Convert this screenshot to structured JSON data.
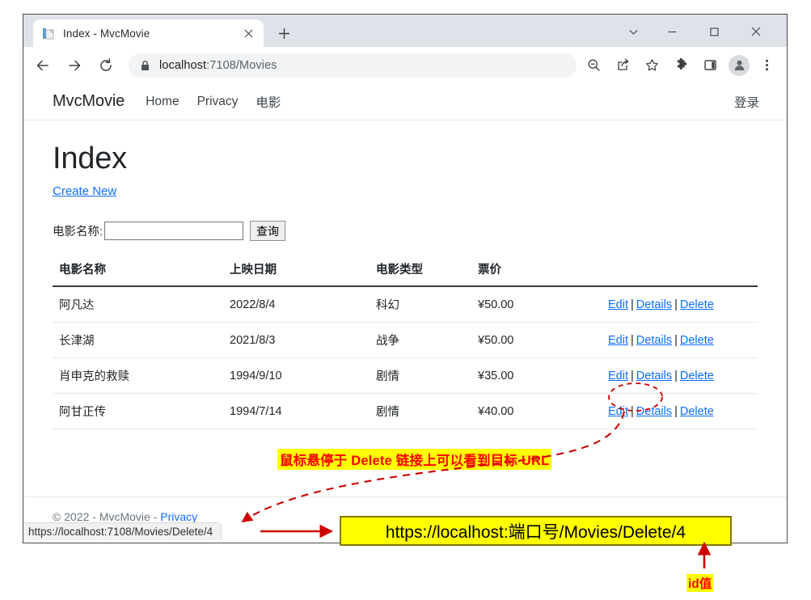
{
  "browser": {
    "tab": {
      "title": "Index - MvcMovie",
      "favicon_icon": "page-document-icon",
      "close_icon": "close-icon"
    },
    "new_tab_icon": "plus-icon",
    "window_controls": {
      "tab_search_icon": "chevron-down-icon",
      "minimize_icon": "minimize-icon",
      "maximize_icon": "maximize-square-icon",
      "close_icon": "close-x-icon"
    },
    "toolbar": {
      "back_icon": "arrow-left-icon",
      "forward_icon": "arrow-right-icon",
      "reload_icon": "reload-icon",
      "lock_icon": "lock-icon",
      "url_host": "localhost",
      "url_path": ":7108/Movies",
      "zoom_out_icon": "zoom-out-icon",
      "share_icon": "share-icon",
      "bookmark_icon": "star-outline-icon",
      "extensions_icon": "puzzle-piece-icon",
      "side_panel_icon": "side-panel-icon",
      "profile_icon": "account-avatar-icon",
      "menu_icon": "three-dot-menu-icon"
    },
    "status_bar": {
      "url": "https://localhost:7108/Movies/Delete/4"
    }
  },
  "site": {
    "brand": "MvcMovie",
    "nav_links": [
      "Home",
      "Privacy",
      "电影"
    ],
    "login_label": "登录",
    "footer": {
      "copyright": "© 2022 - MvcMovie - ",
      "privacy_label": "Privacy"
    }
  },
  "page": {
    "title": "Index",
    "create_new_label": "Create New",
    "search": {
      "label": "电影名称:",
      "value": "",
      "placeholder": "",
      "submit_label": "查询"
    },
    "table": {
      "headers": [
        "电影名称",
        "上映日期",
        "电影类型",
        "票价",
        ""
      ],
      "rows": [
        {
          "title": "阿凡达",
          "date": "2022/8/4",
          "genre": "科幻",
          "price": "¥50.00",
          "actions": [
            "Edit",
            "Details",
            "Delete"
          ]
        },
        {
          "title": "长津湖",
          "date": "2021/8/3",
          "genre": "战争",
          "price": "¥50.00",
          "actions": [
            "Edit",
            "Details",
            "Delete"
          ]
        },
        {
          "title": "肖申克的救赎",
          "date": "1994/9/10",
          "genre": "剧情",
          "price": "¥35.00",
          "actions": [
            "Edit",
            "Details",
            "Delete"
          ]
        },
        {
          "title": "阿甘正传",
          "date": "1994/7/14",
          "genre": "剧情",
          "price": "¥40.00",
          "actions": [
            "Edit",
            "Details",
            "Delete"
          ]
        }
      ],
      "action_separator": "|"
    }
  },
  "annotations": {
    "hover_note": "鼠标悬停于 Delete 链接上可以看到目标 URL",
    "url_box": "https://localhost:端口号/Movies/Delete/4",
    "id_note": "id值",
    "colors": {
      "highlight_bg": "#ffff00",
      "annotation_text": "#ff0000",
      "arrow": "#cc0000",
      "box_border": "#807800"
    }
  }
}
